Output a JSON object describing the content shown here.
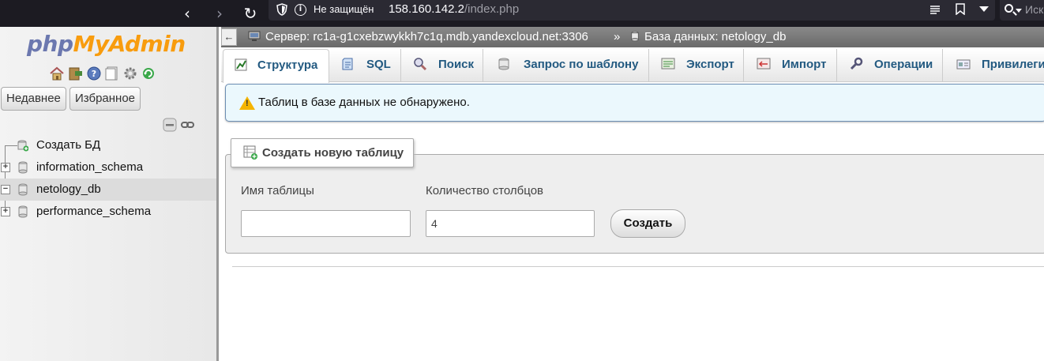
{
  "browser": {
    "back": "‹",
    "forward": "›",
    "reload": "↻",
    "not_secure": "Не защищён",
    "host": "158.160.142.2",
    "path": "/index.php",
    "search_placeholder": "Иск"
  },
  "sidebar": {
    "logo_php": "php",
    "logo_my": "My",
    "logo_admin": "Admin",
    "recent_label": "Недавнее",
    "favorites_label": "Избранное",
    "tree": [
      {
        "label": "Создать БД",
        "type": "new"
      },
      {
        "label": "information_schema",
        "type": "db",
        "expander": "+"
      },
      {
        "label": "netology_db",
        "type": "db",
        "expander": "−",
        "active": true
      },
      {
        "label": "performance_schema",
        "type": "db",
        "expander": "+"
      }
    ]
  },
  "breadcrumb": {
    "back": "←",
    "server": "Сервер: rc1a-g1cxebzwykkh7c1q.mdb.yandexcloud.net:3306",
    "separator": "»",
    "database": "База данных: netology_db"
  },
  "tabs": [
    {
      "label": "Структура",
      "icon": "structure-icon",
      "active": true
    },
    {
      "label": "SQL",
      "icon": "sql-icon"
    },
    {
      "label": "Поиск",
      "icon": "search-icon"
    },
    {
      "label": "Запрос по шаблону",
      "icon": "query-icon"
    },
    {
      "label": "Экспорт",
      "icon": "export-icon"
    },
    {
      "label": "Импорт",
      "icon": "import-icon"
    },
    {
      "label": "Операции",
      "icon": "wrench-icon"
    },
    {
      "label": "Привилеги",
      "icon": "privileges-icon"
    }
  ],
  "notice": "Таблиц в базе данных не обнаружено.",
  "create_table": {
    "legend": "Создать новую таблицу",
    "name_label": "Имя таблицы",
    "name_value": "",
    "columns_label": "Количество столбцов",
    "columns_value": "4",
    "submit": "Создать"
  },
  "colors": {
    "browser_bg": "#1c1b22",
    "urlbar_bg": "#2b2a33",
    "tab_text": "#235a81",
    "notice_bg": "#ebf8fd"
  }
}
